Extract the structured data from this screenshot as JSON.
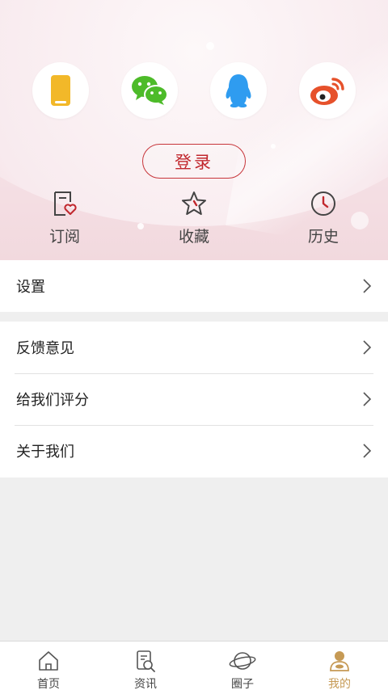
{
  "social": [
    {
      "name": "phone-icon"
    },
    {
      "name": "wechat-icon"
    },
    {
      "name": "qq-icon"
    },
    {
      "name": "weibo-icon"
    }
  ],
  "login": {
    "label": "登录"
  },
  "quick_actions": [
    {
      "label": "订阅",
      "icon": "subscribe-icon"
    },
    {
      "label": "收藏",
      "icon": "star-icon"
    },
    {
      "label": "历史",
      "icon": "clock-icon"
    }
  ],
  "settings": {
    "label": "设置"
  },
  "menu": [
    {
      "label": "反馈意见"
    },
    {
      "label": "给我们评分"
    },
    {
      "label": "关于我们"
    }
  ],
  "tabs": [
    {
      "label": "首页",
      "icon": "home-icon"
    },
    {
      "label": "资讯",
      "icon": "news-icon"
    },
    {
      "label": "圈子",
      "icon": "circle-icon"
    },
    {
      "label": "我的",
      "icon": "profile-icon",
      "active": true
    }
  ],
  "colors": {
    "accent": "#c1272d",
    "tab_active": "#c69a55",
    "phone": "#f2b829",
    "wechat": "#4dbb29",
    "qq": "#2f9cf0",
    "weibo": "#e6512b"
  }
}
